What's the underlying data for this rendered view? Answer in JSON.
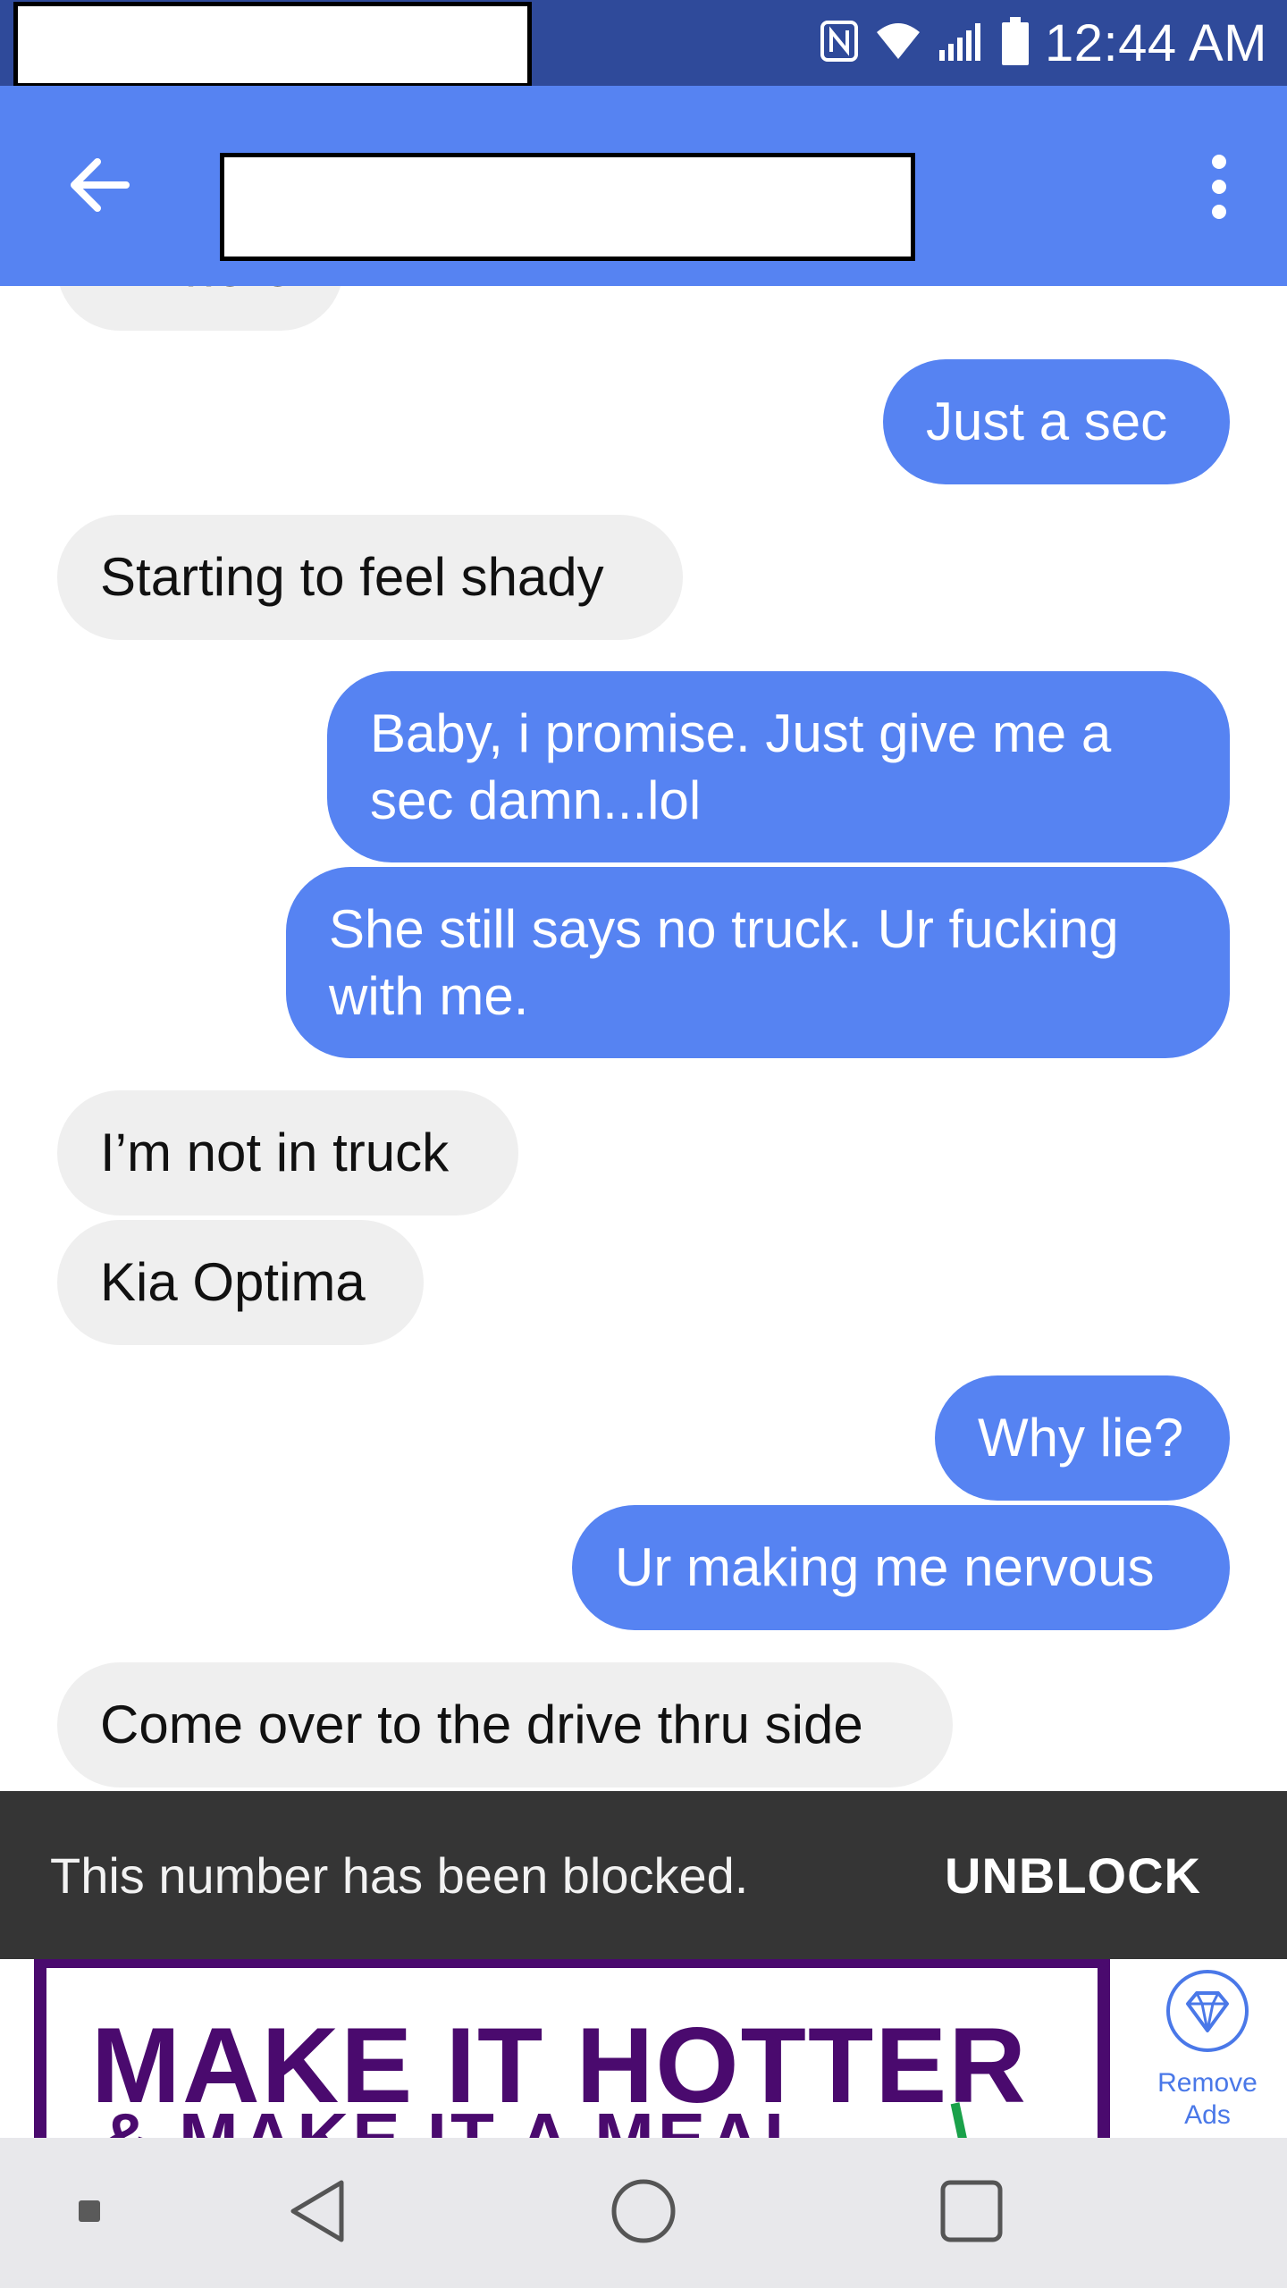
{
  "status_bar": {
    "time": "12:44 AM",
    "icons": [
      "nfc-icon",
      "wifi-icon",
      "signal-icon",
      "battery-icon"
    ]
  },
  "app_bar": {
    "contact_name": "",
    "back_icon": "arrow-back-icon",
    "menu_icon": "more-vert-icon"
  },
  "messages": [
    {
      "direction": "received",
      "text": "I'm here"
    },
    {
      "direction": "sent",
      "text": "Just a sec"
    },
    {
      "direction": "received",
      "text": "Starting to feel shady"
    },
    {
      "direction": "sent",
      "text": "Baby, i promise. Just give me a\nsec damn...lol"
    },
    {
      "direction": "sent",
      "text": "She still says no truck. Ur fucking\nwith me."
    },
    {
      "direction": "received",
      "text": "I’m not in truck"
    },
    {
      "direction": "received",
      "text": "Kia Optima"
    },
    {
      "direction": "sent",
      "text": "Why lie?"
    },
    {
      "direction": "sent",
      "text": "Ur making me nervous"
    },
    {
      "direction": "received",
      "text": "Come over to the drive thru side"
    }
  ],
  "blocked_bar": {
    "message": "This number has been blocked.",
    "action": "UNBLOCK"
  },
  "ad": {
    "headline": "MAKE IT HOTTER",
    "subline": "& MAKE IT A MEAL",
    "remove_ads_label": "Remove Ads"
  },
  "nav_bar": {
    "icons": [
      "recent-dot-icon",
      "back-triangle-icon",
      "home-circle-icon",
      "overview-square-icon"
    ]
  },
  "colors": {
    "status_bar": "#2f4a9a",
    "accent": "#5683f2",
    "received_bubble": "#efefef",
    "blocked_bar": "#353535",
    "ad_purple": "#4a0a6e"
  }
}
